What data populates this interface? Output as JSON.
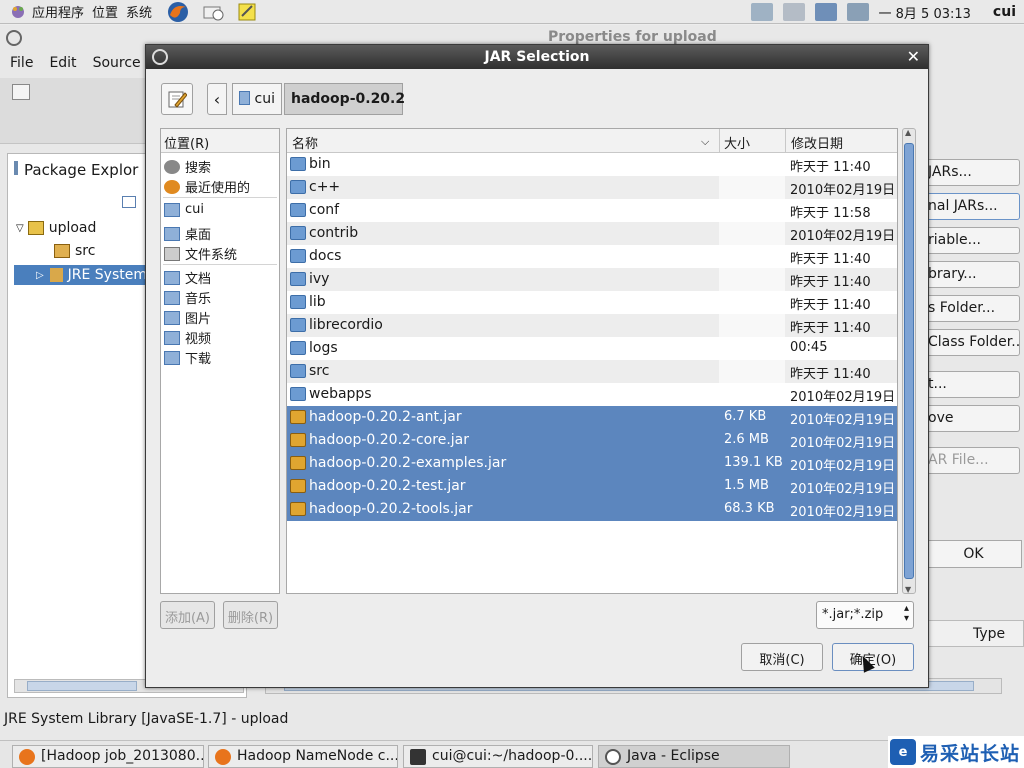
{
  "top_panel": {
    "menus": [
      "应用程序",
      "位置",
      "系统"
    ],
    "clock": "一 8月  5 03:13",
    "user": "cui"
  },
  "eclipse": {
    "menu": [
      "File",
      "Edit",
      "Source"
    ],
    "package_explorer_title": "Package Explor",
    "tree": {
      "project": "upload",
      "src": "src",
      "jre": "JRE System"
    },
    "properties_title": "Properties for upload",
    "side_buttons": [
      "JARs...",
      "nal JARs...",
      "riable...",
      "brary...",
      "s Folder...",
      "Class Folder...",
      "t...",
      "ove",
      "AR File..."
    ],
    "ok": "OK",
    "type_col": "Type",
    "status": "JRE System Library [JavaSE-1.7] - upload"
  },
  "dialog": {
    "title": "JAR Selection",
    "breadcrumb": [
      "cui",
      "hadoop-0.20.2"
    ],
    "places_header": "位置(R)",
    "places": [
      "搜索",
      "最近使用的",
      "cui",
      "桌面",
      "文件系统",
      "文档",
      "音乐",
      "图片",
      "视频",
      "下载"
    ],
    "columns": {
      "name": "名称",
      "size": "大小",
      "modified": "修改日期"
    },
    "files": [
      {
        "name": "bin",
        "size": "",
        "date": "昨天于 11:40",
        "type": "folder",
        "selected": false
      },
      {
        "name": "c++",
        "size": "",
        "date": "2010年02月19日",
        "type": "folder",
        "selected": false
      },
      {
        "name": "conf",
        "size": "",
        "date": "昨天于 11:58",
        "type": "folder",
        "selected": false
      },
      {
        "name": "contrib",
        "size": "",
        "date": "2010年02月19日",
        "type": "folder",
        "selected": false
      },
      {
        "name": "docs",
        "size": "",
        "date": "昨天于 11:40",
        "type": "folder",
        "selected": false
      },
      {
        "name": "ivy",
        "size": "",
        "date": "昨天于 11:40",
        "type": "folder",
        "selected": false
      },
      {
        "name": "lib",
        "size": "",
        "date": "昨天于 11:40",
        "type": "folder",
        "selected": false
      },
      {
        "name": "librecordio",
        "size": "",
        "date": "昨天于 11:40",
        "type": "folder",
        "selected": false
      },
      {
        "name": "logs",
        "size": "",
        "date": "00:45",
        "type": "folder",
        "selected": false
      },
      {
        "name": "src",
        "size": "",
        "date": "昨天于 11:40",
        "type": "folder",
        "selected": false
      },
      {
        "name": "webapps",
        "size": "",
        "date": "2010年02月19日",
        "type": "folder",
        "selected": false
      },
      {
        "name": "hadoop-0.20.2-ant.jar",
        "size": "6.7 KB",
        "date": "2010年02月19日",
        "type": "jar",
        "selected": true
      },
      {
        "name": "hadoop-0.20.2-core.jar",
        "size": "2.6 MB",
        "date": "2010年02月19日",
        "type": "jar",
        "selected": true
      },
      {
        "name": "hadoop-0.20.2-examples.jar",
        "size": "139.1 KB",
        "date": "2010年02月19日",
        "type": "jar",
        "selected": true
      },
      {
        "name": "hadoop-0.20.2-test.jar",
        "size": "1.5 MB",
        "date": "2010年02月19日",
        "type": "jar",
        "selected": true
      },
      {
        "name": "hadoop-0.20.2-tools.jar",
        "size": "68.3 KB",
        "date": "2010年02月19日",
        "type": "jar",
        "selected": true
      }
    ],
    "add": "添加(A)",
    "remove": "删除(R)",
    "filter": "*.jar;*.zip",
    "cancel": "取消(C)",
    "confirm": "确定(O)"
  },
  "taskbar": {
    "tasks": [
      "[Hadoop job_2013080...",
      "Hadoop NameNode c...",
      "cui@cui:~/hadoop-0....",
      "Java - Eclipse"
    ]
  },
  "watermark": {
    "logo": "e",
    "text": "易采站长站"
  }
}
